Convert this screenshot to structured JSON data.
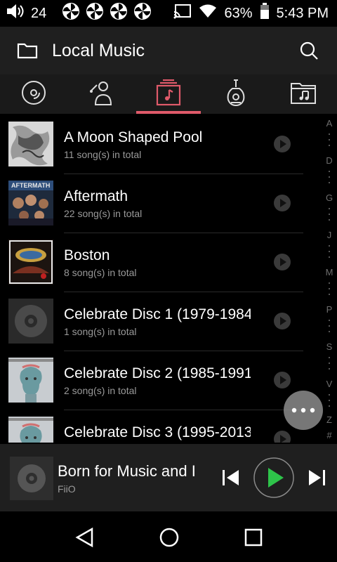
{
  "status": {
    "volume_level": "24",
    "battery_percent": "63%",
    "time": "5:43 PM",
    "notification_icons": [
      "pinwheel-icon",
      "pinwheel-icon",
      "pinwheel-icon",
      "pinwheel-icon"
    ]
  },
  "header": {
    "title": "Local Music"
  },
  "tabs": [
    {
      "icon": "disc-icon",
      "active": false
    },
    {
      "icon": "artist-icon",
      "active": false
    },
    {
      "icon": "album-icon",
      "active": true
    },
    {
      "icon": "genre-guitar-icon",
      "active": false
    },
    {
      "icon": "folder-music-icon",
      "active": false
    }
  ],
  "albums": [
    {
      "name": "A Moon Shaped Pool",
      "count": "11 song(s) in total",
      "art": "moon"
    },
    {
      "name": "Aftermath",
      "count": "22 song(s) in total",
      "art": "aftermath"
    },
    {
      "name": "Boston",
      "count": "8 song(s) in total",
      "art": "boston"
    },
    {
      "name": "Celebrate Disc 1 (1979-1984",
      "count": "1 song(s) in total",
      "art": "disc"
    },
    {
      "name": "Celebrate Disc 2 (1985-1991",
      "count": "2 song(s) in total",
      "art": "celebrate"
    },
    {
      "name": "Celebrate Disc 3 (1995-2013",
      "count": "",
      "art": "celebrate"
    }
  ],
  "index_letters": [
    "A",
    "D",
    "G",
    "J",
    "M",
    "P",
    "S",
    "V",
    "Z",
    "#"
  ],
  "player": {
    "song": "Born for Music and I",
    "artist": "FiiO",
    "state": "paused"
  },
  "colors": {
    "accent": "#e05a6a",
    "play_green": "#2ec44a",
    "appbar_bg": "#1f1f1f"
  }
}
